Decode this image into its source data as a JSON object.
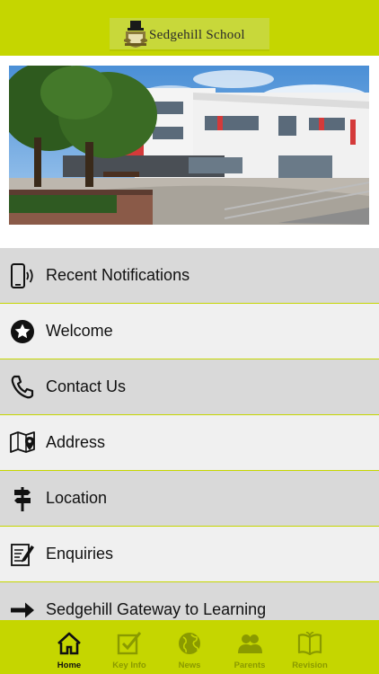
{
  "header": {
    "school_name": "Sedgehill School"
  },
  "menu": {
    "items": [
      {
        "label": "Recent Notifications",
        "icon": "phone-notification-icon"
      },
      {
        "label": "Welcome",
        "icon": "star-icon"
      },
      {
        "label": "Contact Us",
        "icon": "phone-handset-icon"
      },
      {
        "label": "Address",
        "icon": "map-pin-icon"
      },
      {
        "label": "Location",
        "icon": "signpost-icon"
      },
      {
        "label": "Enquiries",
        "icon": "document-edit-icon"
      },
      {
        "label": "Sedgehill Gateway to Learning",
        "icon": "arrow-right-icon"
      }
    ]
  },
  "tabbar": {
    "tabs": [
      {
        "label": "Home",
        "icon": "home-icon",
        "active": true
      },
      {
        "label": "Key Info",
        "icon": "checkbox-icon",
        "active": false
      },
      {
        "label": "News",
        "icon": "globe-icon",
        "active": false
      },
      {
        "label": "Parents",
        "icon": "people-icon",
        "active": false
      },
      {
        "label": "Revision",
        "icon": "book-icon",
        "active": false
      }
    ]
  },
  "colors": {
    "accent": "#c5d600",
    "row_dark": "#d9d9d9",
    "row_light": "#f0f0f0",
    "tab_inactive": "#8a9a00"
  }
}
